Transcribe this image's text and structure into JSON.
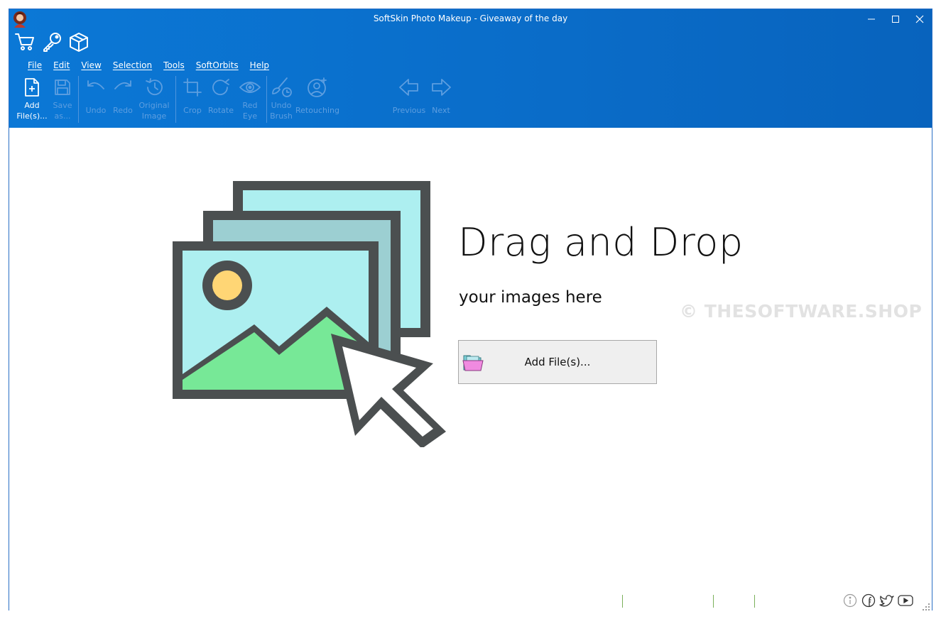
{
  "window": {
    "title": "SoftSkin Photo Makeup - Giveaway of the day",
    "accent_color": "#0a6cc8"
  },
  "quick_icons": [
    "cart-icon",
    "key-icon",
    "package-icon"
  ],
  "menu": {
    "items": [
      "File",
      "Edit",
      "View",
      "Selection",
      "Tools",
      "SoftOrbits",
      "Help"
    ]
  },
  "toolbar": {
    "add_files": "Add\nFile(s)...",
    "save_as": "Save\nas...",
    "undo": "Undo",
    "redo": "Redo",
    "original_image": "Original\nImage",
    "crop": "Crop",
    "rotate": "Rotate",
    "red_eye": "Red\nEye",
    "undo_brush": "Undo\nBrush",
    "retouching": "Retouching",
    "previous": "Previous",
    "next": "Next"
  },
  "main": {
    "drop_title": "Drag and Drop",
    "drop_subtitle": "your images here",
    "add_files_button": "Add File(s)...",
    "watermark": "© THESOFTWARE.SHOP"
  },
  "statusbar": {
    "icons": [
      "info-icon",
      "facebook-icon",
      "twitter-icon",
      "youtube-icon"
    ]
  }
}
